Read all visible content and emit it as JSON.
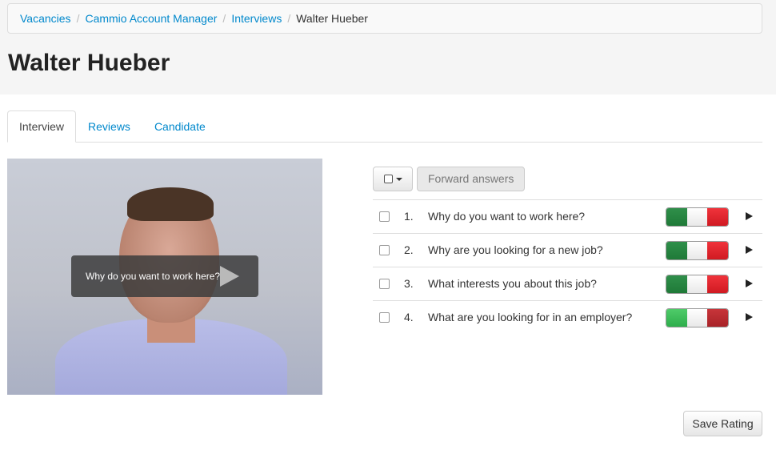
{
  "breadcrumb": {
    "items": [
      "Vacancies",
      "Cammio Account Manager",
      "Interviews"
    ],
    "current": "Walter Hueber",
    "separator": "/"
  },
  "page": {
    "title": "Walter Hueber"
  },
  "tabs": [
    {
      "label": "Interview",
      "active": true
    },
    {
      "label": "Reviews",
      "active": false
    },
    {
      "label": "Candidate",
      "active": false
    }
  ],
  "video": {
    "overlay_text": "Why do you want to work here?"
  },
  "toolbar": {
    "forward_label": "Forward answers"
  },
  "questions": [
    {
      "num": "1.",
      "text": "Why do you want to work here?",
      "rating": "neutral"
    },
    {
      "num": "2.",
      "text": "Why are you looking for a new job?",
      "rating": "neutral"
    },
    {
      "num": "3.",
      "text": "What interests you about this job?",
      "rating": "neutral"
    },
    {
      "num": "4.",
      "text": "What are you looking for in an employer?",
      "rating": "neutral"
    }
  ],
  "actions": {
    "save_label": "Save Rating"
  },
  "colors": {
    "link": "#0088cc",
    "green": "#1f7a38",
    "red": "#d01a22"
  }
}
